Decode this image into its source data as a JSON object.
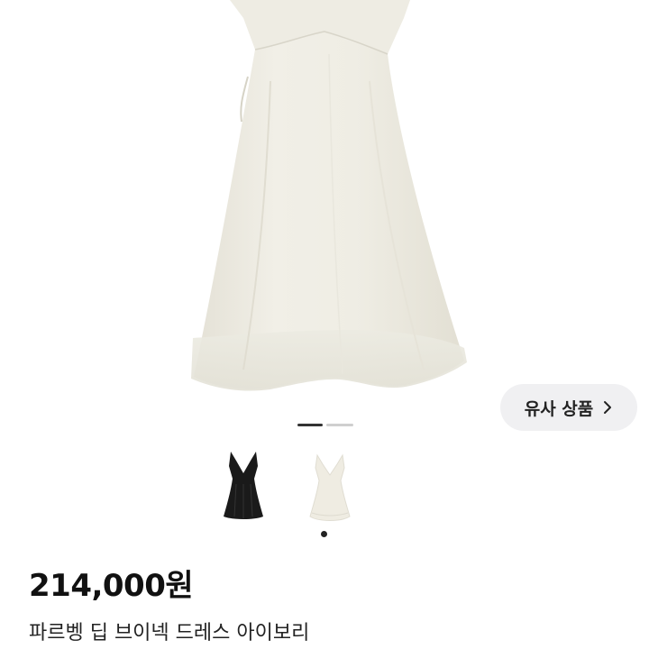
{
  "product": {
    "price": "214,000원",
    "name": "파르벵 딥 브이넥 드레스 아이보리"
  },
  "actions": {
    "similar_items_label": "유사 상품"
  },
  "gallery": {
    "current_slide": 1,
    "total_slides": 2,
    "thumbnails": [
      {
        "name": "black-dress-thumbnail",
        "color": "#1a1a1a"
      },
      {
        "name": "ivory-dress-thumbnail",
        "color": "#efece2",
        "selected": true
      }
    ]
  },
  "colors": {
    "dress_ivory": "#efece2",
    "button_bg": "#f0f0f2",
    "indicator_active": "#333333",
    "indicator_inactive": "#cfcfcf"
  }
}
